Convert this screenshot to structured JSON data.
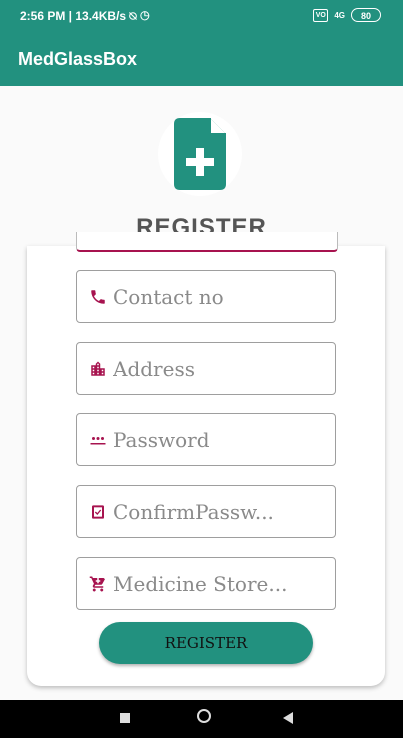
{
  "status_bar": {
    "time_text": "2:56 PM | 13.4KB/s",
    "alarm_icons": "⍉ ◷",
    "network": "4G",
    "battery": "80"
  },
  "app_bar": {
    "title": "MedGlassBox"
  },
  "form": {
    "heading": "REGISTER",
    "fields": [
      {
        "name": "contact",
        "placeholder": "Contact no",
        "icon": "phone-icon"
      },
      {
        "name": "address",
        "placeholder": "Address",
        "icon": "building-icon"
      },
      {
        "name": "password",
        "placeholder": "Password",
        "icon": "password-dots-icon"
      },
      {
        "name": "confirm",
        "placeholder": "ConfirmPassw...",
        "icon": "check-clipboard-icon"
      },
      {
        "name": "store",
        "placeholder": "Medicine Store...",
        "icon": "cart-icon"
      }
    ],
    "submit_label": "REGISTER"
  },
  "colors": {
    "primary": "#22917f",
    "icon_accent": "#a7134f"
  }
}
